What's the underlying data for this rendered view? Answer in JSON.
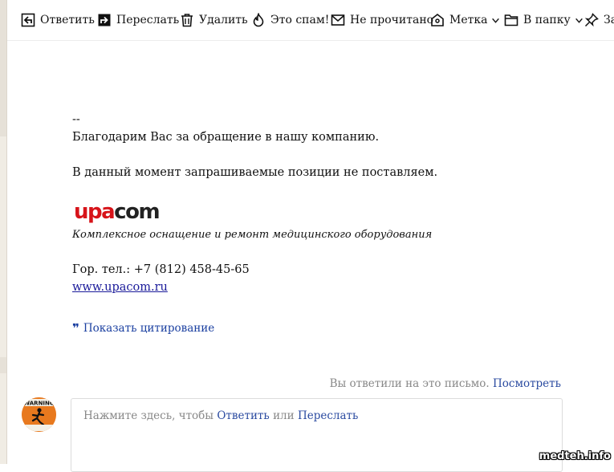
{
  "toolbar": {
    "reply": "Ответить",
    "forward": "Переслать",
    "delete": "Удалить",
    "spam": "Это спам!",
    "unread": "Не прочитано",
    "label": "Метка",
    "folder": "В папку",
    "pin": "За"
  },
  "message": {
    "dashes": "--",
    "thanks": "Благодарим Вас за обращение в нашу компанию.",
    "notice": "В данный момент запрашиваемые позиции не поставляем.",
    "logo_text": "upacom",
    "tagline": "Комплексное оснащение и ремонт медицинского оборудования",
    "phone": "Гор. тел.: +7 (812) 458-45-65",
    "website": "www.upacom.ru",
    "show_quote": "Показать цитирование"
  },
  "status": {
    "replied_text": "Вы ответили на это письмо.",
    "view_link": "Посмотреть"
  },
  "reply": {
    "prompt_prefix": "Нажмите здесь, чтобы",
    "reply_link": "Ответить",
    "or_text": "или",
    "forward_link": "Переслать"
  },
  "avatar": {
    "text": "WARNING"
  },
  "watermark": "medteh.info",
  "colors": {
    "link": "#2a4aa0",
    "logo_red": "#d7141a",
    "logo_dark": "#222222",
    "avatar": "#e8791e"
  }
}
